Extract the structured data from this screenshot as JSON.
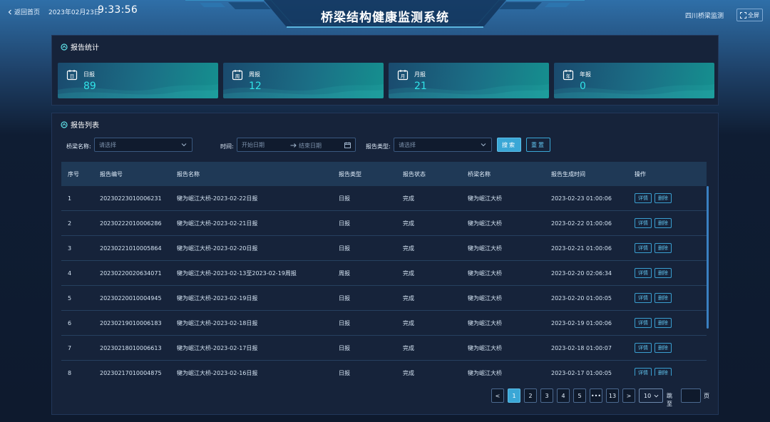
{
  "header": {
    "back_label": "返回首页",
    "date": "2023年02月23日",
    "time": "9:33:56",
    "title": "桥梁结构健康监测系统",
    "org": "四川桥梁监测",
    "fullscreen_label": "全屏"
  },
  "stats": {
    "title": "报告统计",
    "cards": [
      {
        "label": "日报",
        "value": "89",
        "icon": "calendar-day-icon",
        "glyph": "日"
      },
      {
        "label": "周报",
        "value": "12",
        "icon": "calendar-week-icon",
        "glyph": "周"
      },
      {
        "label": "月报",
        "value": "21",
        "icon": "calendar-month-icon",
        "glyph": "月"
      },
      {
        "label": "年报",
        "value": "0",
        "icon": "calendar-year-icon",
        "glyph": "年"
      }
    ]
  },
  "list": {
    "title": "报告列表",
    "filters": {
      "bridge_label": "桥梁名称:",
      "bridge_placeholder": "请选择",
      "time_label": "时间:",
      "start_placeholder": "开始日期",
      "end_placeholder": "结束日期",
      "type_label": "报告类型:",
      "type_placeholder": "请选择",
      "search_label": "搜索",
      "reset_label": "重置"
    },
    "columns": [
      "序号",
      "报告编号",
      "报告名称",
      "报告类型",
      "报告状态",
      "桥梁名称",
      "报告生成时间",
      "操作"
    ],
    "rows": [
      [
        "1",
        "20230223010006231",
        "犍为岷江大桥-2023-02-22日报",
        "日报",
        "完成",
        "犍为岷江大桥",
        "2023-02-23 01:00:06"
      ],
      [
        "2",
        "20230222010006286",
        "犍为岷江大桥-2023-02-21日报",
        "日报",
        "完成",
        "犍为岷江大桥",
        "2023-02-22 01:00:06"
      ],
      [
        "3",
        "20230221010005864",
        "犍为岷江大桥-2023-02-20日报",
        "日报",
        "完成",
        "犍为岷江大桥",
        "2023-02-21 01:00:06"
      ],
      [
        "4",
        "20230220020634071",
        "犍为岷江大桥-2023-02-13至2023-02-19周报",
        "周报",
        "完成",
        "犍为岷江大桥",
        "2023-02-20 02:06:34"
      ],
      [
        "5",
        "20230220010004945",
        "犍为岷江大桥-2023-02-19日报",
        "日报",
        "完成",
        "犍为岷江大桥",
        "2023-02-20 01:00:05"
      ],
      [
        "6",
        "20230219010006183",
        "犍为岷江大桥-2023-02-18日报",
        "日报",
        "完成",
        "犍为岷江大桥",
        "2023-02-19 01:00:06"
      ],
      [
        "7",
        "20230218010006613",
        "犍为岷江大桥-2023-02-17日报",
        "日报",
        "完成",
        "犍为岷江大桥",
        "2023-02-18 01:00:07"
      ],
      [
        "8",
        "20230217010004875",
        "犍为岷江大桥-2023-02-16日报",
        "日报",
        "完成",
        "犍为岷江大桥",
        "2023-02-17 01:00:05"
      ]
    ],
    "row_actions": {
      "detail": "详情",
      "delete": "删除"
    }
  },
  "pagination": {
    "prev": "<",
    "pages": [
      "1",
      "2",
      "3",
      "4",
      "5",
      "•••",
      "13"
    ],
    "active_page": "1",
    "next": ">",
    "page_size": "10",
    "goto_label": "跳至",
    "page_unit": "页"
  },
  "colors": {
    "accent": "#3aa7d6",
    "stat_value": "#31e3e8",
    "panel_bg": "#16233a"
  }
}
